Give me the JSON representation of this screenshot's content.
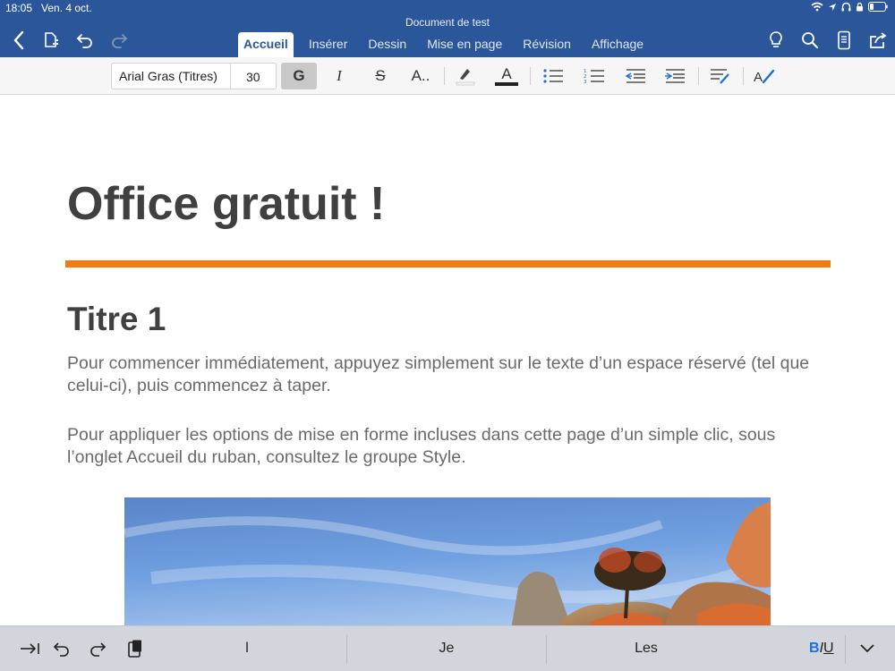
{
  "status_bar": {
    "time": "18:05",
    "date": "Ven. 4 oct."
  },
  "header": {
    "doc_title": "Document de test",
    "tabs": [
      "Accueil",
      "Insérer",
      "Dessin",
      "Mise en page",
      "Révision",
      "Affichage"
    ],
    "active_tab": "Accueil"
  },
  "ribbon": {
    "font_name": "Arial Gras (Titres)",
    "font_size": "30",
    "bold_label": "G",
    "italic_label": "I",
    "strike_label": "S",
    "text_effects_label": "A..",
    "font_color_label": "A"
  },
  "document": {
    "title": "Office gratuit !",
    "heading1": "Titre 1",
    "paragraph1": "Pour commencer immédiatement, appuyez simplement sur le texte d’un espace réservé (tel que celui-ci), puis commencez à taper.",
    "paragraph2": "Pour appliquer les options de mise en forme incluses dans cette page d’un simple clic, sous l’onglet Accueil du ruban, consultez le groupe Style."
  },
  "keyboard": {
    "suggestions": [
      "l",
      "Je",
      "Les"
    ],
    "bold": "B",
    "italic": "I",
    "underline": "U"
  },
  "colors": {
    "header_blue": "#2b579a",
    "accent_orange": "#f27b13",
    "heading_gray": "#404040",
    "body_gray": "#6a6a6a"
  },
  "icons": {
    "back": "chevron-left-icon",
    "file": "file-icon",
    "undo": "undo-icon",
    "redo": "redo-icon",
    "ideas": "lightbulb-icon",
    "search": "search-icon",
    "mobile_view": "mobile-view-icon",
    "share": "share-icon"
  }
}
